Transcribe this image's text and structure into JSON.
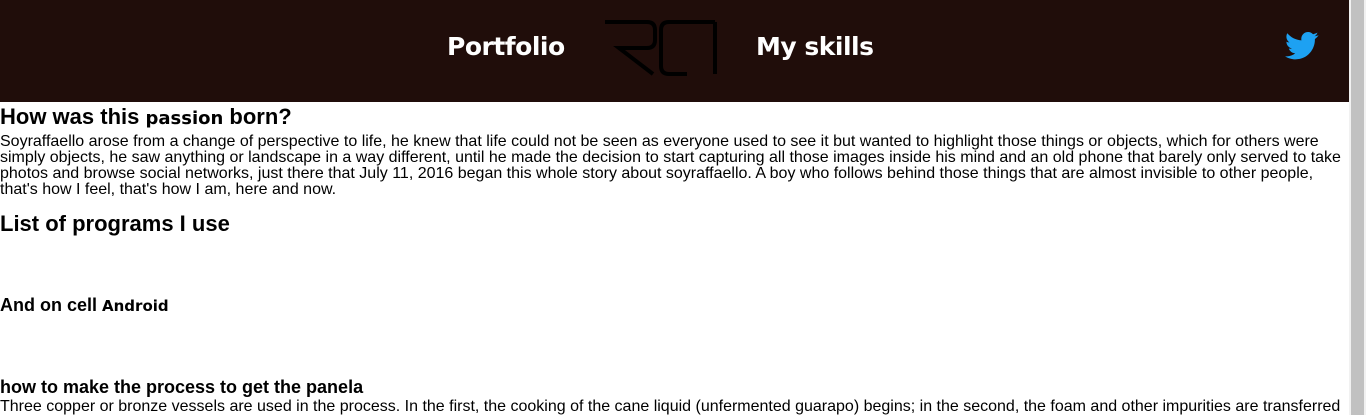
{
  "header": {
    "nav": [
      {
        "label": "Portfolio"
      },
      {
        "label": "My skills"
      }
    ],
    "logo_icon": "rd-monogram-logo",
    "social_icon": "twitter-bird-icon",
    "background_color": "#200d0a",
    "twitter_color": "#1da1f2"
  },
  "section_passion": {
    "heading_pre": "How was this ",
    "heading_small": "passion",
    "heading_post": " born?",
    "body": "Soyraffaello arose from a change of perspective to life, he knew that life could not be seen as everyone used to see it but wanted to highlight those things or objects, which for others were simply objects, he saw anything or landscape in a way different, until he made the decision to start capturing all those images inside his mind and an old phone that barely only served to take photos and browse social networks, just there that July 11, 2016 began this whole story about soyraffaello. A boy who follows behind those things that are almost invisible to other people, that's how I feel, that's how I am, here and now."
  },
  "section_programs": {
    "heading": "List of programs I use"
  },
  "section_cell": {
    "heading_pre": "And on cell ",
    "heading_small": "Android"
  },
  "section_panela": {
    "heading": "how to make the process to get the panela",
    "body": "Three copper or bronze vessels are used in the process. In the first, the cooking of the cane liquid (unfermented guarapo) begins; in the second, the foam and other impurities are transferred"
  }
}
